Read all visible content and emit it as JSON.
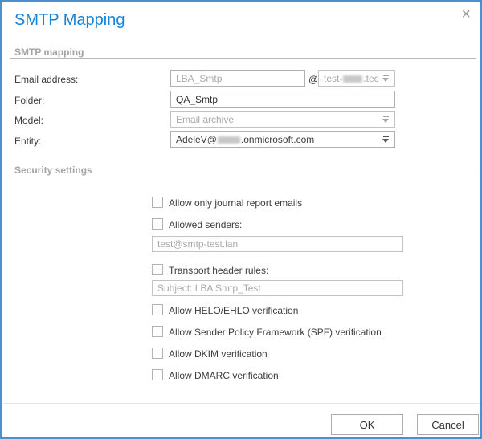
{
  "dialog": {
    "title": "SMTP Mapping",
    "close_icon": "×"
  },
  "sections": {
    "mapping": "SMTP mapping",
    "security": "Security settings"
  },
  "fields": {
    "email_address": {
      "label": "Email address:",
      "placeholder": "LBA_Smtp",
      "at_symbol": "@",
      "domain_prefix": "test-",
      "domain_suffix": ".tec",
      "domain_redacted": true,
      "domain_disabled": true
    },
    "folder": {
      "label": "Folder:",
      "value": "QA_Smtp"
    },
    "model": {
      "label": "Model:",
      "value": "Email archive",
      "disabled": true
    },
    "entity": {
      "label": "Entity:",
      "value_prefix": "AdeleV@",
      "value_suffix": ".onmicrosoft.com",
      "redacted": true
    }
  },
  "security": {
    "checkboxes": [
      {
        "label": "Allow only journal report emails",
        "checked": false
      },
      {
        "label": "Allowed senders:",
        "checked": false,
        "input_placeholder": "test@smtp-test.lan"
      },
      {
        "label": "Transport header rules:",
        "checked": false,
        "input_placeholder": "Subject: LBA Smtp_Test"
      },
      {
        "label": "Allow HELO/EHLO verification",
        "checked": false
      },
      {
        "label": "Allow Sender Policy Framework (SPF) verification",
        "checked": false
      },
      {
        "label": "Allow DKIM verification",
        "checked": false
      },
      {
        "label": "Allow DMARC verification",
        "checked": false
      }
    ]
  },
  "buttons": {
    "ok": "OK",
    "cancel": "Cancel"
  },
  "colors": {
    "accent_blue": "#1583d8",
    "border_blue": "#4a90d2",
    "section_gray": "#a3a3a3",
    "disabled_text": "#a9a9a9"
  }
}
